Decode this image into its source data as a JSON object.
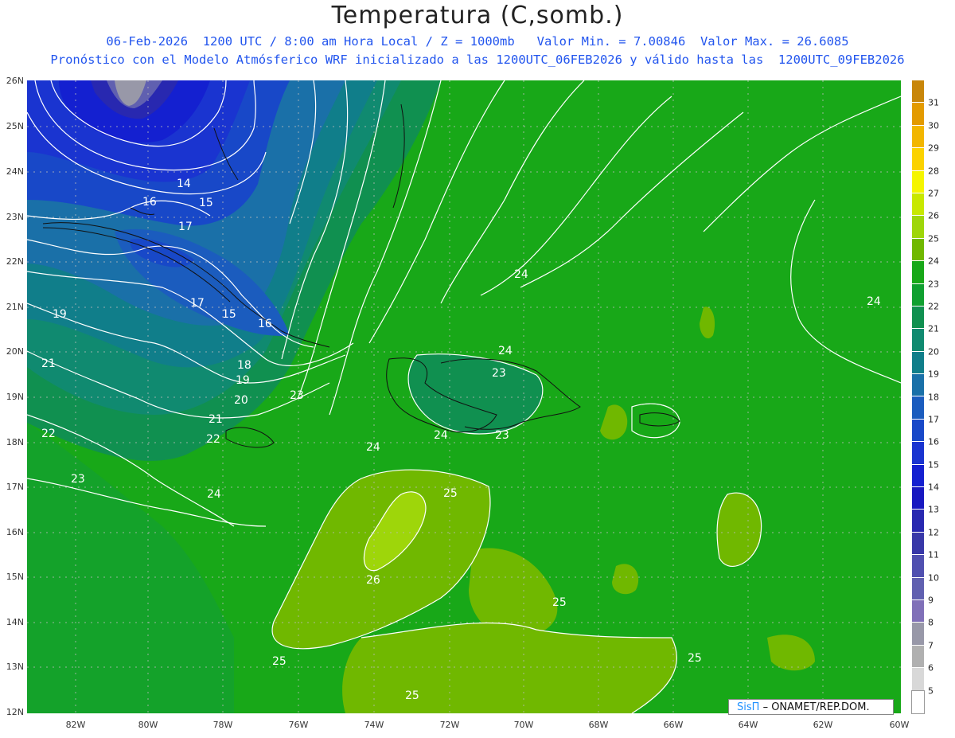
{
  "header": {
    "title": "Temperatura (C,somb.)",
    "line1": "06-Feb-2026  1200 UTC / 8:00 am Hora Local / Z = 1000mb   Valor Min. = 7.00846  Valor Max. = 26.6085",
    "line2": "Pronóstico con el Modelo Atmósferico WRF inicializado a las 1200UTC_06FEB2026 y válido hasta las  1200UTC_09FEB2026"
  },
  "lat_labels": [
    "26N",
    "25N",
    "24N",
    "23N",
    "22N",
    "21N",
    "20N",
    "19N",
    "18N",
    "17N",
    "16N",
    "15N",
    "14N",
    "13N",
    "12N"
  ],
  "lon_labels": [
    "82W",
    "80W",
    "78W",
    "76W",
    "74W",
    "72W",
    "70W",
    "68W",
    "66W",
    "64W",
    "62W",
    "60W"
  ],
  "colorbar": {
    "labels": [
      "31",
      "30",
      "29",
      "28",
      "27",
      "26",
      "25",
      "24",
      "23",
      "22",
      "21",
      "20",
      "19",
      "18",
      "17",
      "16",
      "15",
      "14",
      "13",
      "12",
      "11",
      "10",
      "9",
      "8",
      "7",
      "6",
      "5"
    ],
    "colors": [
      "#c8860a",
      "#e39a00",
      "#f2b600",
      "#fbd200",
      "#f5f500",
      "#c8e800",
      "#9ed60a",
      "#70b800",
      "#18a818",
      "#10a030",
      "#109050",
      "#108a70",
      "#107e8a",
      "#1a70a8",
      "#1b5cbe",
      "#1848c8",
      "#1a34d0",
      "#1420d0",
      "#1818c0",
      "#2828b0",
      "#3838a8",
      "#5050b0",
      "#6060b0",
      "#8070b8",
      "#9898a8",
      "#b0b0b0",
      "#d8d8d8",
      "#ffffff"
    ]
  },
  "contour_labels": [
    "14",
    "15",
    "16",
    "17",
    "15",
    "17",
    "16",
    "19",
    "21",
    "18",
    "19",
    "20",
    "23",
    "21",
    "22",
    "22",
    "23",
    "24",
    "24",
    "23",
    "24",
    "24",
    "23",
    "24",
    "24",
    "25",
    "26",
    "25",
    "25",
    "25",
    "25"
  ],
  "credit": {
    "brand": "SisΠ",
    "rest": "– ONAMET/REP.DOM."
  }
}
